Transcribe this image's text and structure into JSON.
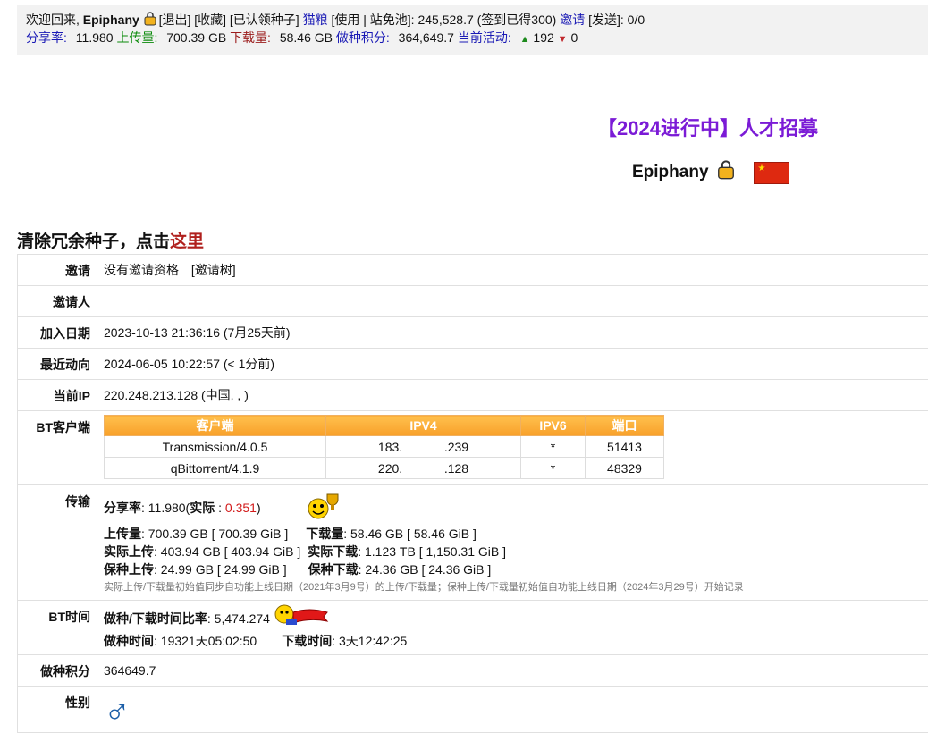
{
  "topbar": {
    "welcome": "欢迎回来, ",
    "username": "Epiphany",
    "logout": "[退出]",
    "favorites": "[收藏]",
    "claimed": "[已认领种子]",
    "catfood": "猫粮",
    "use_pool": "[使用 | 站免池]: 245,528.7 (签到已得300)",
    "invite": "邀请",
    "send": "[发送]: 0/0",
    "ratio_label": "分享率:",
    "ratio_value": "11.980",
    "upload_label": "上传量:",
    "upload_value": "700.39 GB",
    "download_label": "下载量:",
    "download_value": "58.46 GB",
    "bonus_label": "做种积分:",
    "bonus_value": "364,649.7",
    "active_label": "当前活动:",
    "seeding_count": "192",
    "leeching_count": "0"
  },
  "recruit": "【2024进行中】人才招募",
  "profile_name": "Epiphany",
  "cleanup": {
    "text": "清除冗余种子，点击",
    "link": "这里"
  },
  "rows": {
    "invite": {
      "label": "邀请",
      "value": "没有邀请资格",
      "tree": "[邀请树]"
    },
    "inviter": {
      "label": "邀请人",
      "value": ""
    },
    "joined": {
      "label": "加入日期",
      "value": "2023-10-13 21:36:16 (7月25天前)"
    },
    "last_action": {
      "label": "最近动向",
      "value": "2024-06-05 10:22:57 (< 1分前)"
    },
    "ip": {
      "label": "当前IP",
      "value": "220.248.213.128 (中国, , )"
    },
    "bt_client": {
      "label": "BT客户端"
    },
    "transfer": {
      "label": "传输"
    },
    "bt_time": {
      "label": "BT时间"
    },
    "seed_bonus": {
      "label": "做种积分",
      "value": "364649.7"
    },
    "gender": {
      "label": "性别"
    }
  },
  "clients": {
    "headers": [
      "客户端",
      "IPV4",
      "IPV6",
      "端口"
    ],
    "rows": [
      {
        "client": "Transmission/4.0.5",
        "ipv4": "183.            .239",
        "ipv6": "*",
        "port": "51413"
      },
      {
        "client": "qBittorrent/4.1.9",
        "ipv4": "220.            .128",
        "ipv6": "*",
        "port": "48329"
      }
    ]
  },
  "transfer": {
    "ratio_label": "分享率",
    "ratio_value": ": 11.980(",
    "actual_label": "实际",
    "actual_value": "0.351",
    "upload_label": "上传量",
    "upload_value": ": 700.39 GB [ 700.39 GiB ]",
    "download_label": "下载量",
    "download_value": ": 58.46 GB [ 58.46 GiB ]",
    "real_up_label": "实际上传",
    "real_up_value": ": 403.94 GB [ 403.94 GiB ]",
    "real_down_label": "实际下载",
    "real_down_value": ": 1.123 TB [ 1,150.31 GiB ]",
    "keep_up_label": "保种上传",
    "keep_up_value": ": 24.99 GB [ 24.99 GiB ]",
    "keep_down_label": "保种下载",
    "keep_down_value": ": 24.36 GB [ 24.36 GiB ]",
    "note": "实际上传/下载量初始值同步自功能上线日期（2021年3月9号）的上传/下载量；保种上传/下载量初始值自功能上线日期（2024年3月29号）开始记录"
  },
  "bt_time": {
    "ratio_label": "做种/下载时间比率",
    "ratio_value": ": 5,474.274",
    "seed_time_label": "做种时间",
    "seed_time_value": ": 19321天05:02:50",
    "dl_time_label": "下载时间",
    "dl_time_value": ": 3天12:42:25"
  },
  "gender_symbol": "♂"
}
